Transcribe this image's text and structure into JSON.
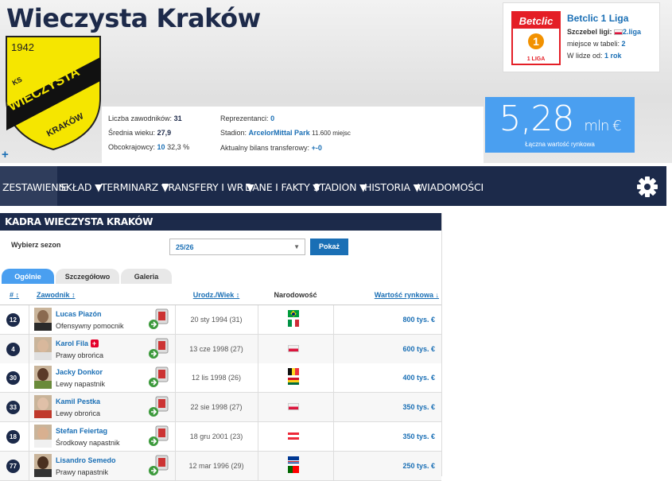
{
  "club": {
    "name": "Wieczysta Kraków",
    "logo_year": "1942",
    "logo_text_top": "KS",
    "logo_text_main": "WIECZYSTA",
    "logo_text_bottom": "KRAKÓW"
  },
  "info": {
    "squad_size_label": "Liczba zawodników:",
    "squad_size": "31",
    "avg_age_label": "Średnia wieku:",
    "avg_age": "27,9",
    "foreigners_label": "Obcokrajowcy:",
    "foreigners": "10",
    "foreigners_pct": "32,3 %",
    "internationals_label": "Reprezentanci:",
    "internationals": "0",
    "stadium_label": "Stadion:",
    "stadium": "ArcelorMittal Park",
    "stadium_seats": "11.600 miejsc",
    "transfer_label": "Aktualny bilans transferowy:",
    "transfer": "+-0"
  },
  "league": {
    "name": "Betclic 1 Liga",
    "logo_brand": "Betclic",
    "logo_sub": "1 LIGA",
    "level_label": "Szczebel ligi:",
    "level": "2.liga",
    "table_label": "miejsce w tabeli:",
    "table_pos": "2",
    "since_label": "W lidze od:",
    "since": "1 rok"
  },
  "market_value": {
    "amount": "5,28",
    "unit": "mln €",
    "caption": "Łączna wartość rynkowa"
  },
  "nav": {
    "items": [
      "ZESTAWIENIE",
      "SKŁAD ▼",
      "TERMINARZ ▼",
      "TRANSFERY I WR ▼",
      "DANE I FAKTY ▼",
      "STADION ▼",
      "HISTORIA ▼",
      "WIADOMOŚCI"
    ]
  },
  "squad": {
    "title": "KADRA WIECZYSTA KRAKÓW",
    "season_label": "Wybierz sezon",
    "season_value": "25/26",
    "show_button": "Pokaż",
    "tabs": [
      "Ogólnie",
      "Szczegółowo",
      "Galeria"
    ],
    "headers": {
      "num": "# ↕",
      "player": "Zawodnik ↕",
      "dob": "Urodz./Wiek ↕",
      "nat": "Narodowość",
      "value": "Wartość rynkowa ↓"
    },
    "players": [
      {
        "num": "12",
        "name": "Lucas Piazón",
        "pos": "Ofensywny pomocnik",
        "dob": "20 sty 1994 (31)",
        "value": "800 tys. €",
        "flags": [
          "brazil",
          "italy"
        ],
        "skin": "#8a6a50",
        "shirt": "#2a2a2a"
      },
      {
        "num": "4",
        "name": "Karol Fila",
        "pos": "Prawy obrońca",
        "dob": "13 cze 1998 (27)",
        "value": "600 tys. €",
        "flags": [
          "poland"
        ],
        "skin": "#d8b89c",
        "shirt": "#e0e0e0",
        "injury": true
      },
      {
        "num": "30",
        "name": "Jacky Donkor",
        "pos": "Lewy napastnik",
        "dob": "12 lis 1998 (26)",
        "value": "400 tys. €",
        "flags": [
          "belgium",
          "ghana"
        ],
        "skin": "#5a3a28",
        "shirt": "#6a8a3a"
      },
      {
        "num": "33",
        "name": "Kamil Pestka",
        "pos": "Lewy obrońca",
        "dob": "22 sie 1998 (27)",
        "value": "350 tys. €",
        "flags": [
          "poland"
        ],
        "skin": "#e0c0a8",
        "shirt": "#c0392b"
      },
      {
        "num": "18",
        "name": "Stefan Feiertag",
        "pos": "Środkowy napastnik",
        "dob": "18 gru 2001 (23)",
        "value": "350 tys. €",
        "flags": [
          "austria"
        ],
        "skin": "#d8b090",
        "shirt": "#f0f0f0"
      },
      {
        "num": "77",
        "name": "Lisandro Semedo",
        "pos": "Prawy napastnik",
        "dob": "12 mar 1996 (29)",
        "value": "250 tys. €",
        "flags": [
          "capeverde",
          "portugal"
        ],
        "skin": "#4a3020",
        "shirt": "#333333"
      }
    ]
  },
  "colors": {
    "navy": "#1c2a4a",
    "accent": "#1a6fb5",
    "value_bg": "#4a9ff0",
    "logo_yellow": "#f5e600"
  }
}
